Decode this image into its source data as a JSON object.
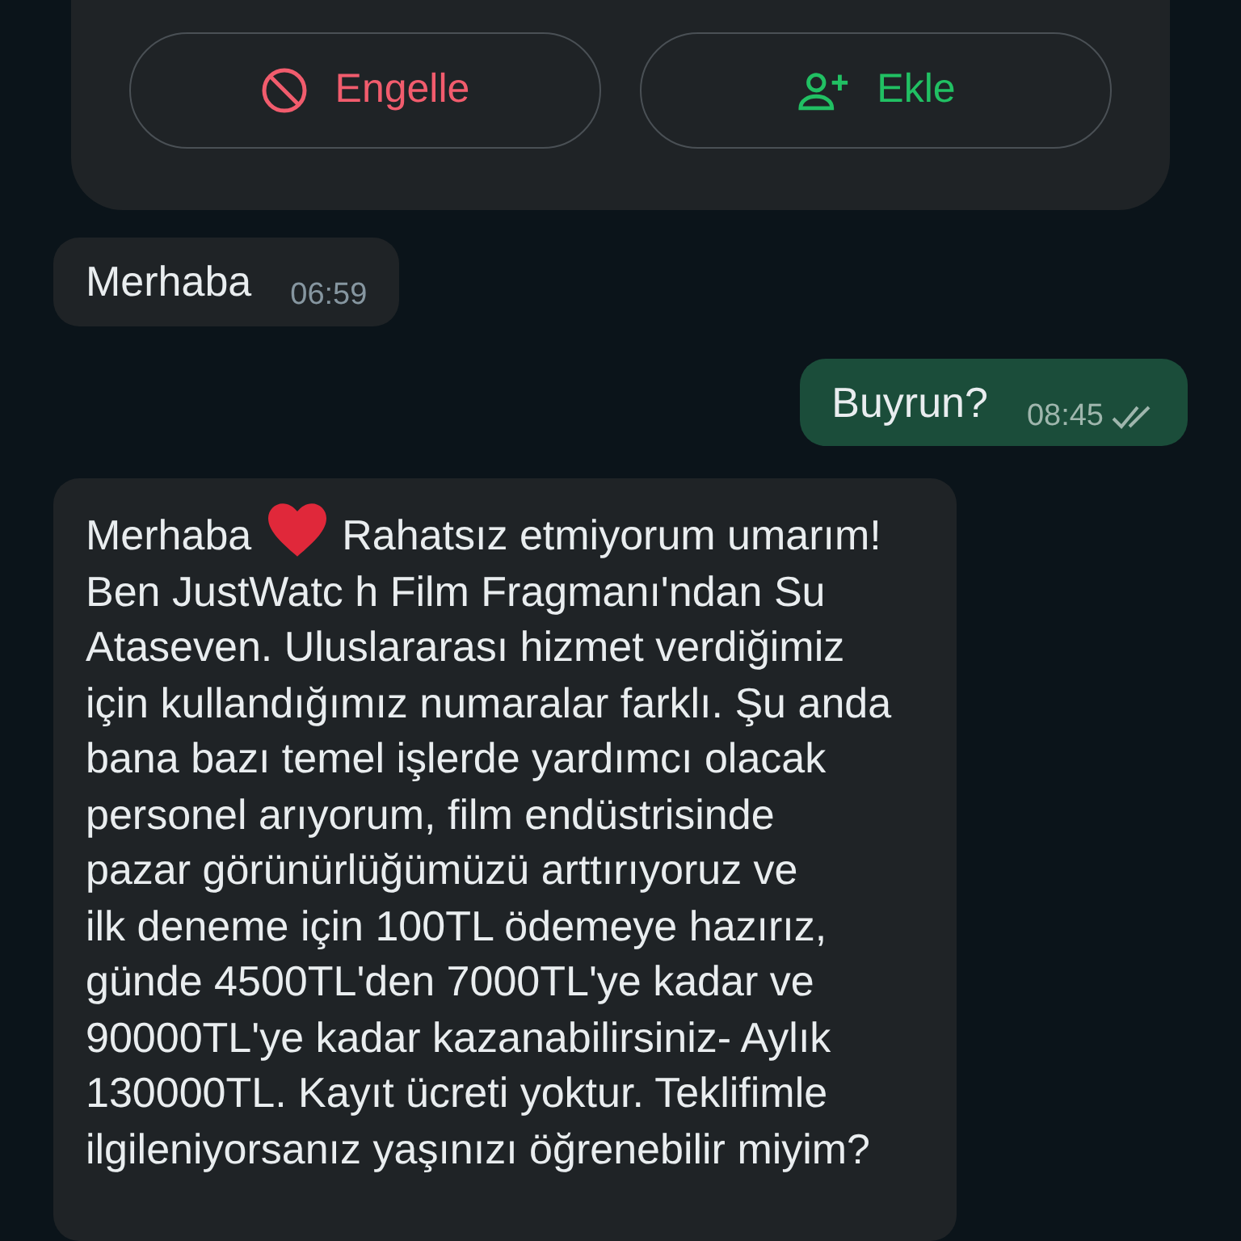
{
  "contact_card": {
    "buttons": [
      {
        "kind": "block",
        "label": "Engelle"
      },
      {
        "kind": "add",
        "label": "Ekle"
      }
    ]
  },
  "messages": [
    {
      "outgoing": false,
      "lines": [
        [
          "Merhaba"
        ]
      ],
      "time": "06:59"
    },
    {
      "outgoing": true,
      "lines": [
        [
          "Buyrun?"
        ]
      ],
      "time": "08:45",
      "read": false
    },
    {
      "outgoing": false,
      "lines": [
        [
          "Merhaba",
          "Rahatsız etmiyorum umarım!"
        ],
        [
          "Ben JustWatc h Film Fragmanı'ndan Su"
        ],
        [
          "Ataseven. Uluslararası hizmet verdiğimiz"
        ],
        [
          "için kullandığımız numaralar farklı. Şu anda"
        ],
        [
          "bana bazı temel işlerde yardımcı olacak"
        ],
        [
          "personel arıyorum, film endüstrisinde"
        ],
        [
          "pazar görünürlüğümüzü arttırıyoruz ve"
        ],
        [
          "ilk deneme için 100TL ödemeye hazırız,"
        ],
        [
          "günde 4500TL'den 7000TL'ye kadar ve"
        ],
        [
          "90000TL'ye kadar kazanabilirsiniz- Aylık"
        ],
        [
          "130000TL. Kayıt ücreti yoktur. Teklifimle"
        ],
        [
          "ilgileniyorsanız yaşınızı öğrenebilir miyim?"
        ]
      ]
    }
  ]
}
